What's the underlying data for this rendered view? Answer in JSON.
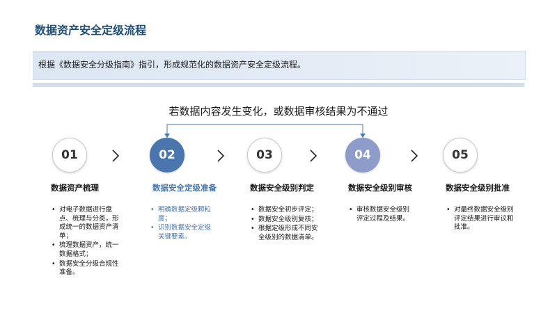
{
  "page": {
    "title": "数据资产安全定级流程",
    "banner": "根据《数据安全分级指南》指引，形成规范化的数据资产安全定级流程。",
    "loop_note": "若数据内容发生变化，或数据审核结果为不通过"
  },
  "steps": [
    {
      "number": "01",
      "title": "数据资产梳理",
      "state": "default",
      "bullets": [
        "对电子数据进行盘点、梳理与分类，形成统一的数据资产清单；",
        "梳理数据资产，统一数据格式；",
        "数据安全分级合规性准备。"
      ]
    },
    {
      "number": "02",
      "title": "数据安全定级准备",
      "state": "active",
      "bullets": [
        "明确数据定级颗粒度；",
        "识别数据安全定级关键要素。"
      ]
    },
    {
      "number": "03",
      "title": "数据安全级别判定",
      "state": "default",
      "bullets": [
        "数据安全初步评定；",
        "数据安全级别复核；",
        "根据定级形成不同安全级别的数据清单。"
      ]
    },
    {
      "number": "04",
      "title": "数据安全级别审核",
      "state": "review",
      "bullets": [
        "审核数据安全级别评定过程及结果。"
      ]
    },
    {
      "number": "05",
      "title": "数据安全级别批准",
      "state": "default",
      "bullets": [
        "对最终数据安全级别评定结果进行审议和批准。"
      ]
    }
  ],
  "colors": {
    "title": "#1f4e79",
    "active": "#4a76ad",
    "review": "#8d9cc8",
    "connector": "#4a76ad"
  }
}
